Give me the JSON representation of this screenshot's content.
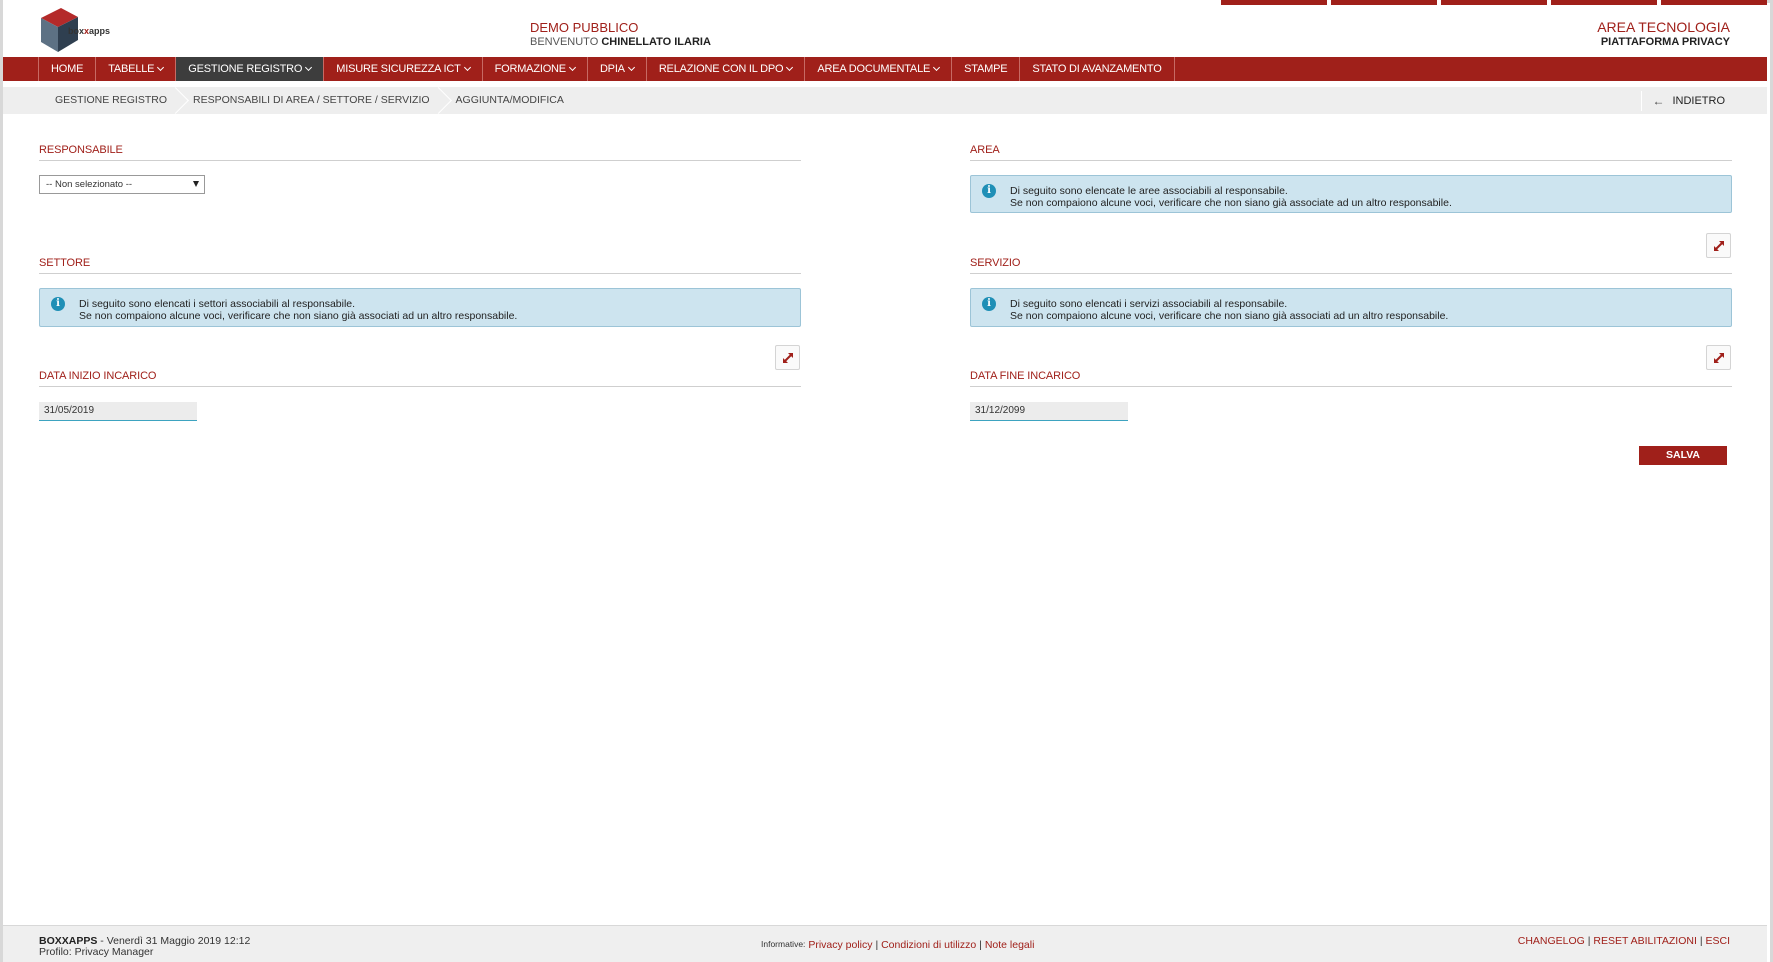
{
  "header": {
    "logo_text_prefix": "box",
    "logo_text_x": "x",
    "logo_text_suffix": "apps",
    "org_name": "DEMO PUBBLICO",
    "welcome_prefix": "BENVENUTO",
    "user_name": "CHINELLATO ILARIA",
    "area_title": "AREA TECNOLOGIA",
    "platform": "PIATTAFORMA PRIVACY"
  },
  "nav": {
    "items": [
      {
        "label": "HOME"
      },
      {
        "label": "TABELLE"
      },
      {
        "label": "GESTIONE REGISTRO"
      },
      {
        "label": "MISURE SICUREZZA ICT"
      },
      {
        "label": "FORMAZIONE"
      },
      {
        "label": "DPIA"
      },
      {
        "label": "RELAZIONE CON IL DPO"
      },
      {
        "label": "AREA DOCUMENTALE"
      },
      {
        "label": "STAMPE"
      },
      {
        "label": "STATO DI AVANZAMENTO"
      }
    ]
  },
  "breadcrumb": {
    "items": [
      "GESTIONE REGISTRO",
      "RESPONSABILI DI AREA / SETTORE / SERVIZIO",
      "AGGIUNTA/MODIFICA"
    ],
    "back_label": "INDIETRO"
  },
  "form": {
    "responsabile": {
      "title": "RESPONSABILE",
      "selected": "-- Non selezionato --"
    },
    "area": {
      "title": "AREA",
      "info_line1": "Di seguito sono elencate le aree associabili al responsabile.",
      "info_line2": "Se non compaiono alcune voci, verificare che non siano già associate ad un altro responsabile."
    },
    "settore": {
      "title": "SETTORE",
      "info_line1": "Di seguito sono elencati i settori associabili al responsabile.",
      "info_line2": "Se non compaiono alcune voci, verificare che non siano già associati ad un altro responsabile."
    },
    "servizio": {
      "title": "SERVIZIO",
      "info_line1": "Di seguito sono elencati i servizi associabili al responsabile.",
      "info_line2": "Se non compaiono alcune voci, verificare che non siano già associati ad un altro responsabile."
    },
    "data_inizio": {
      "title": "DATA INIZIO INCARICO",
      "value": "31/05/2019"
    },
    "data_fine": {
      "title": "DATA FINE INCARICO",
      "value": "31/12/2099"
    },
    "save_label": "SALVA"
  },
  "footer": {
    "brand": "BOXXAPPS",
    "datetime": " - Venerdì 31 Maggio 2019 12:12",
    "profile": "Profilo: Privacy Manager",
    "informative_label": "Informative:",
    "privacy_policy": "Privacy policy",
    "conditions": "Condizioni di utilizzo",
    "legal_notes": "Note legali",
    "changelog": "CHANGELOG",
    "reset": "RESET ABILITAZIONI",
    "logout": "ESCI"
  },
  "colors": {
    "brand_red": "#a0201a",
    "nav_active": "#3d3d3d",
    "info_bg": "#cde4ef",
    "info_icon": "#1f8fb6"
  },
  "icons": {
    "expand": "expand-arrows-icon",
    "info": "info-circle-icon",
    "back": "arrow-left-icon",
    "dropdown": "caret-down-icon",
    "logo": "cube-logo-icon"
  }
}
